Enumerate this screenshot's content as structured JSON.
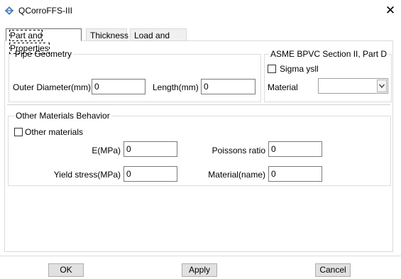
{
  "window": {
    "title": "QCorroFFS-III",
    "close_glyph": "✕"
  },
  "tabs": [
    {
      "label": "Part and Properties",
      "active": true
    },
    {
      "label": "Thickness",
      "active": false
    },
    {
      "label": "Load and Job",
      "active": false
    }
  ],
  "pipe_geometry": {
    "title": "Pipe Geometry",
    "outer_diameter": {
      "label": "Outer Diameter(mm)",
      "value": "0"
    },
    "length": {
      "label": "Length(mm)",
      "value": "0"
    }
  },
  "asme": {
    "title": "ASME BPVC Section II, Part D",
    "sigma_checkbox": {
      "label": "Sigma ysll",
      "checked": false
    },
    "material": {
      "label": "Material",
      "value": ""
    }
  },
  "other_materials": {
    "title": "Other Materials Behavior",
    "checkbox": {
      "label": "Other materials",
      "checked": false
    },
    "e_mpa": {
      "label": "E(MPa)",
      "value": "0"
    },
    "poissons": {
      "label": "Poissons ratio",
      "value": "0"
    },
    "yield_stress": {
      "label": "Yield stress(MPa)",
      "value": "0"
    },
    "material_name": {
      "label": "Material(name)",
      "value": "0"
    }
  },
  "buttons": {
    "ok": "OK",
    "apply": "Apply",
    "cancel": "Cancel"
  },
  "icons": {
    "app": "diamond-arrows-icon",
    "dropdown": "chevron-down-icon"
  }
}
